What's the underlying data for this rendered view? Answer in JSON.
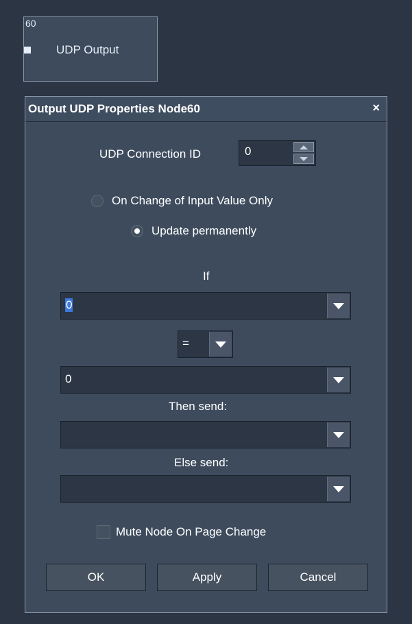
{
  "node": {
    "id": "60",
    "label": "UDP Output"
  },
  "dialog": {
    "title": "Output UDP Properties Node60",
    "close_glyph": "×",
    "connection_label": "UDP Connection ID",
    "connection_value": "0",
    "radio_change_label": "On Change of Input Value Only",
    "radio_permanent_label": "Update permanently",
    "selected_mode": "Update permanently",
    "if_label": "If",
    "if_value": "0",
    "operator_value": "=",
    "compare_value": "0",
    "then_label": "Then send:",
    "then_value": "",
    "else_label": "Else send:",
    "else_value": "",
    "mute_label": "Mute Node On Page Change",
    "mute_checked": false,
    "ok_label": "OK",
    "apply_label": "Apply",
    "cancel_label": "Cancel"
  },
  "colors": {
    "background": "#2b3543",
    "panel": "#3d4b5d",
    "field": "#2c3644",
    "selection": "#3b78d8"
  }
}
